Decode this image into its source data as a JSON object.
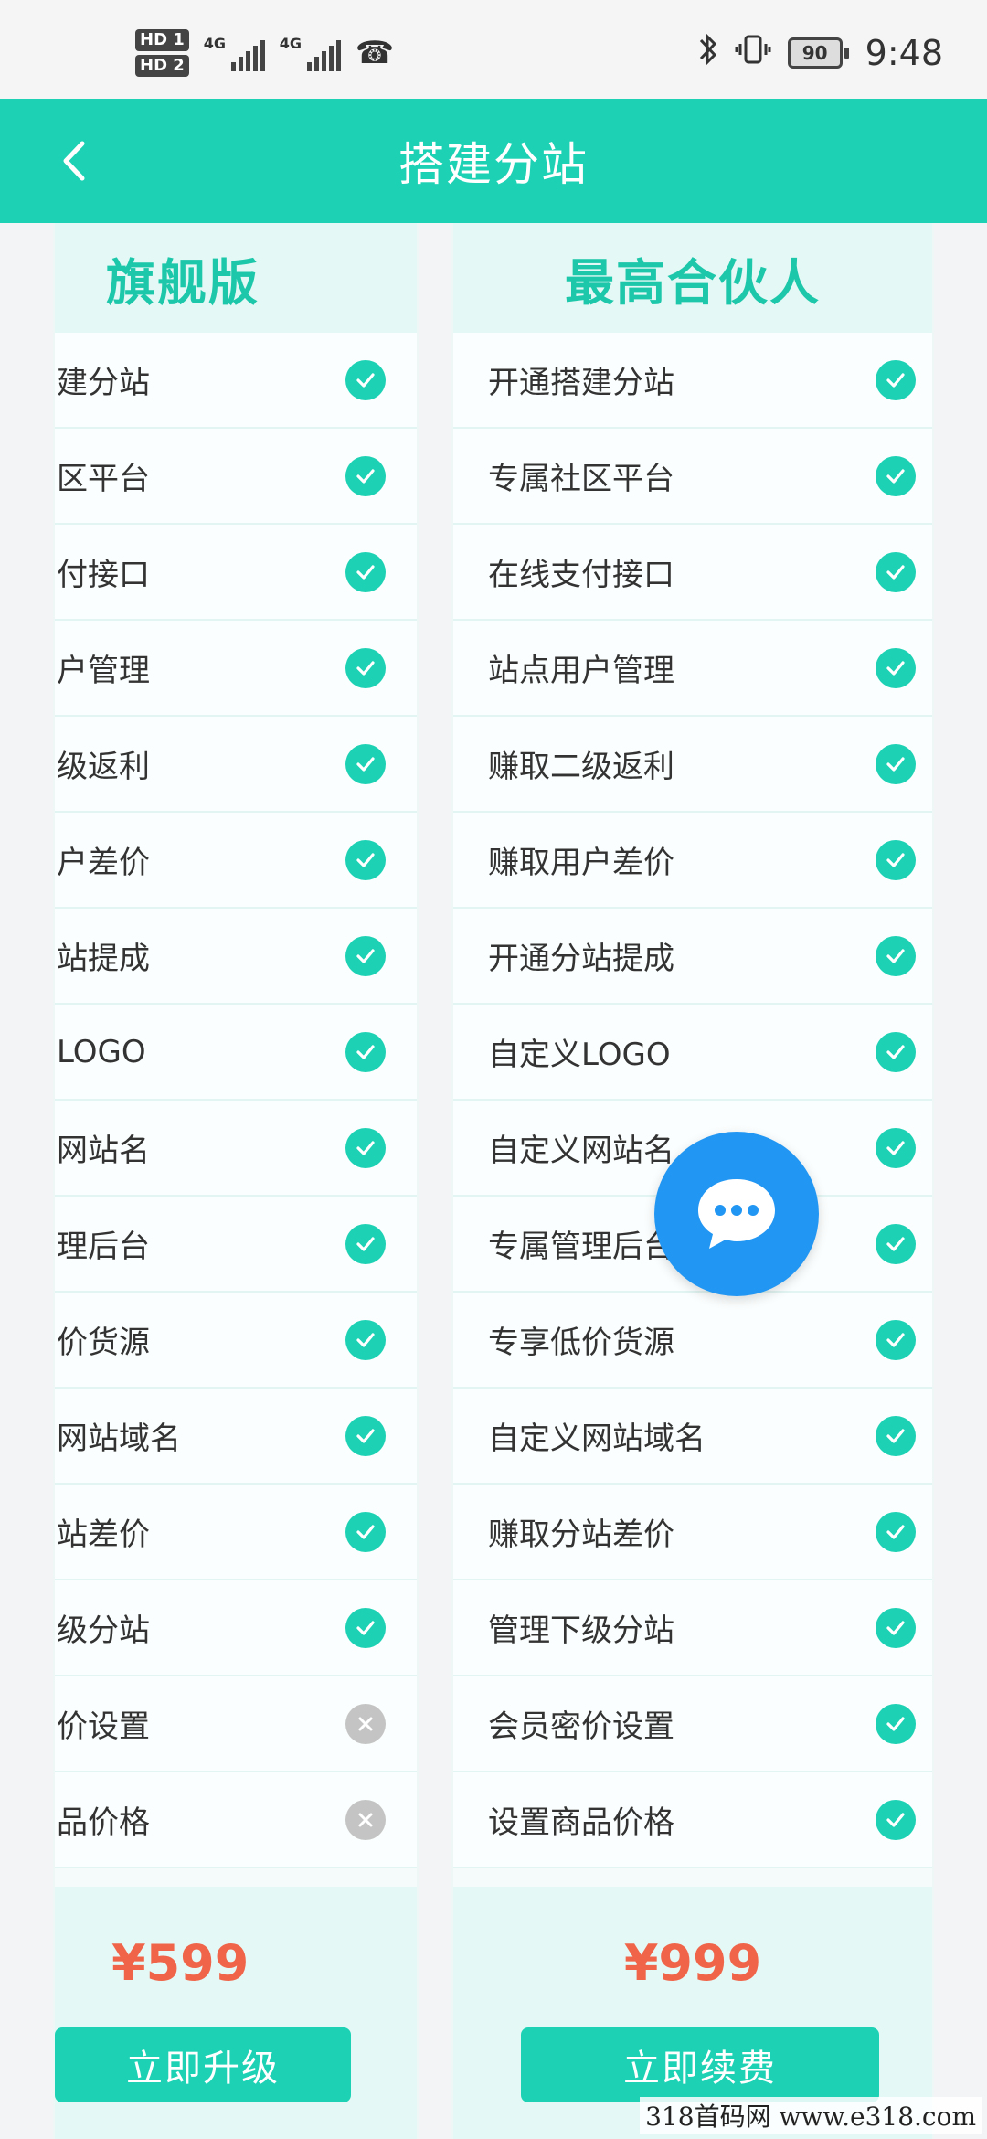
{
  "status_bar": {
    "hd1": "HD 1",
    "hd2": "HD 2",
    "net1": "4G",
    "net2": "4G",
    "battery": "90",
    "time": "9:48"
  },
  "header": {
    "title": "搭建分站"
  },
  "plans": [
    {
      "name": "旗舰版",
      "price": "¥599",
      "button": "立即升级",
      "features": [
        {
          "label": "建分站",
          "included": true
        },
        {
          "label": "区平台",
          "included": true
        },
        {
          "label": "付接口",
          "included": true
        },
        {
          "label": "户管理",
          "included": true
        },
        {
          "label": "级返利",
          "included": true
        },
        {
          "label": "户差价",
          "included": true
        },
        {
          "label": "站提成",
          "included": true
        },
        {
          "label": "LOGO",
          "included": true
        },
        {
          "label": "网站名",
          "included": true
        },
        {
          "label": "理后台",
          "included": true
        },
        {
          "label": "价货源",
          "included": true
        },
        {
          "label": "网站域名",
          "included": true
        },
        {
          "label": "站差价",
          "included": true
        },
        {
          "label": "级分站",
          "included": true
        },
        {
          "label": "价设置",
          "included": false
        },
        {
          "label": "品价格",
          "included": false
        }
      ]
    },
    {
      "name": "最高合伙人",
      "price": "¥999",
      "button": "立即续费",
      "features": [
        {
          "label": "开通搭建分站",
          "included": true
        },
        {
          "label": "专属社区平台",
          "included": true
        },
        {
          "label": "在线支付接口",
          "included": true
        },
        {
          "label": "站点用户管理",
          "included": true
        },
        {
          "label": "赚取二级返利",
          "included": true
        },
        {
          "label": "赚取用户差价",
          "included": true
        },
        {
          "label": "开通分站提成",
          "included": true
        },
        {
          "label": "自定义LOGO",
          "included": true
        },
        {
          "label": "自定义网站名",
          "included": true
        },
        {
          "label": "专属管理后台",
          "included": true
        },
        {
          "label": "专享低价货源",
          "included": true
        },
        {
          "label": "自定义网站域名",
          "included": true
        },
        {
          "label": "赚取分站差价",
          "included": true
        },
        {
          "label": "管理下级分站",
          "included": true
        },
        {
          "label": "会员密价设置",
          "included": true
        },
        {
          "label": "设置商品价格",
          "included": true
        }
      ]
    }
  ],
  "watermark": "318首码网  www.e318.com",
  "colors": {
    "accent": "#1dd2b4",
    "price": "#f0654a",
    "fab": "#2196f3",
    "disabled": "#c4c4c4"
  },
  "icons": {
    "back": "chevron-left-icon",
    "chat": "chat-bubble-icon",
    "check": "check-circle-icon",
    "cross": "x-circle-icon"
  }
}
